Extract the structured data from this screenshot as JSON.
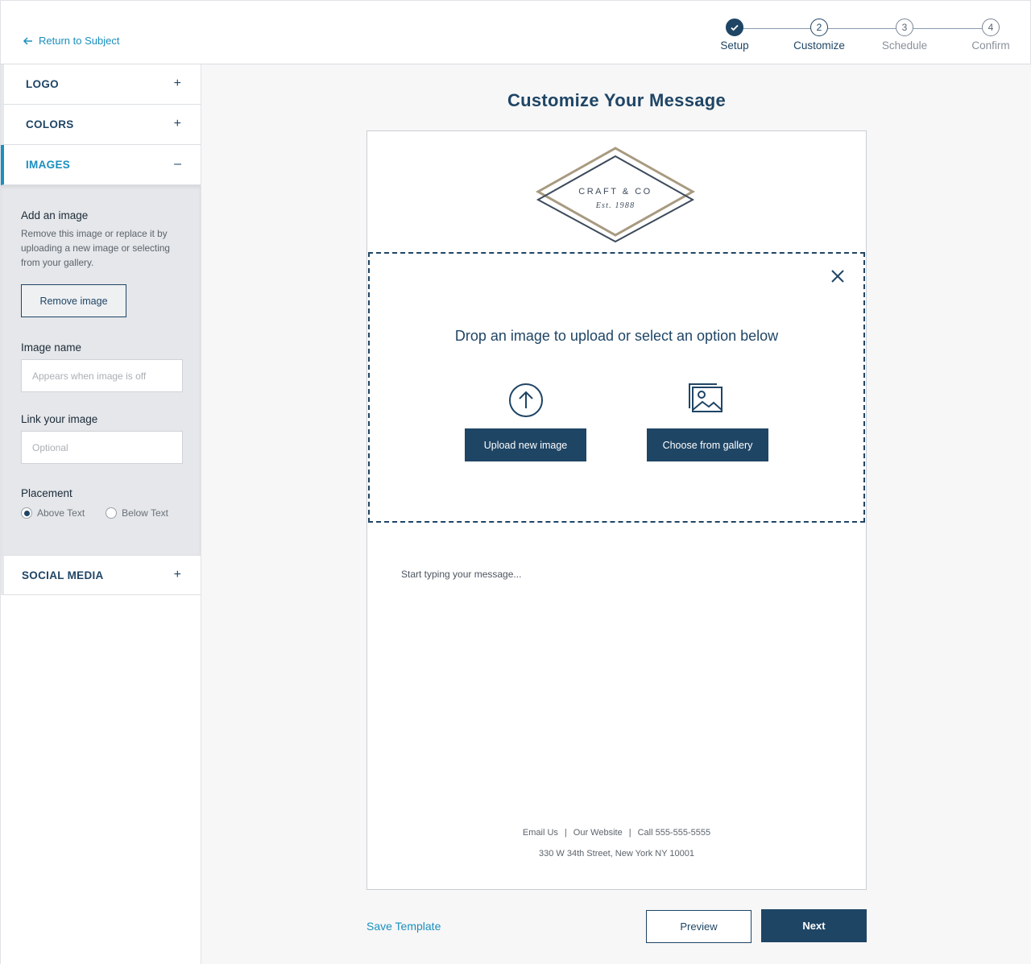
{
  "header": {
    "back_link": "Return to Subject",
    "steps": [
      {
        "number": "",
        "label": "Setup",
        "state": "done"
      },
      {
        "number": "2",
        "label": "Customize",
        "state": "active"
      },
      {
        "number": "3",
        "label": "Schedule",
        "state": "upcoming"
      },
      {
        "number": "4",
        "label": "Confirm",
        "state": "upcoming"
      }
    ]
  },
  "sidebar": {
    "sections": [
      {
        "title": "LOGO",
        "toggle": "+"
      },
      {
        "title": "COLORS",
        "toggle": "+"
      },
      {
        "title": "IMAGES",
        "toggle": "–"
      },
      {
        "title": "SOCIAL MEDIA",
        "toggle": "+"
      }
    ],
    "images_panel": {
      "heading": "Add an image",
      "description": "Remove this image or replace it by uploading a new image or selecting from your gallery.",
      "remove_button": "Remove image",
      "image_name_label": "Image name",
      "image_name_placeholder": "Appears when image is off",
      "link_label": "Link your image",
      "link_placeholder": "Optional",
      "placement_label": "Placement",
      "placement_options": [
        "Above Text",
        "Below Text"
      ],
      "placement_selected": "Above Text"
    }
  },
  "main": {
    "title": "Customize Your Message",
    "logo": {
      "line1": "CRAFT & CO",
      "line2": "Est. 1988"
    },
    "dropzone": {
      "text": "Drop an image to upload or select an option below",
      "upload_button": "Upload new image",
      "gallery_button": "Choose from gallery"
    },
    "message_placeholder": "Start typing your message...",
    "footer": {
      "links": [
        "Email Us",
        "Our Website",
        "Call 555-555-5555"
      ],
      "address": "330 W 34th Street, New York NY 10001"
    }
  },
  "actions": {
    "save_template": "Save Template",
    "preview": "Preview",
    "next": "Next"
  },
  "colors": {
    "brand_navy": "#1f4565",
    "accent_blue": "#1a8fbf",
    "logo_gold": "#a89a80"
  }
}
